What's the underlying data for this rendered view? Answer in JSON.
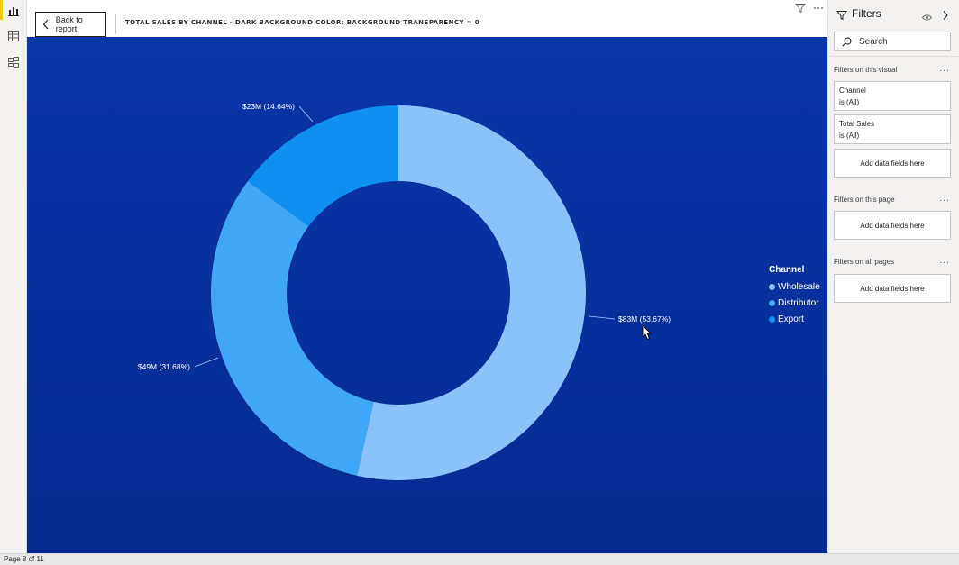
{
  "rail": {
    "items": [
      {
        "icon": "report-view-icon",
        "active": true
      },
      {
        "icon": "data-view-icon",
        "active": false
      },
      {
        "icon": "model-view-icon",
        "active": false
      }
    ]
  },
  "header": {
    "back_label": "Back to report",
    "visual_title": "TOTAL SALES BY CHANNEL - DARK BACKGROUND COLOR; BACKGROUND TRANSPARENCY = 0",
    "filter_icon": "funnel-icon",
    "more_icon": "more-options-icon"
  },
  "colors": {
    "background_top": "#0a36aa",
    "background_bottom": "#052b92",
    "wholesale": "#89c3f9",
    "distributor": "#3fa7f5",
    "export": "#0f8ff2",
    "label_text": "#ffffff"
  },
  "chart_data": {
    "type": "pie",
    "variant": "donut",
    "legend_title": "Channel",
    "legend_position": "right",
    "categories": [
      "Wholesale",
      "Distributor",
      "Export"
    ],
    "values": [
      83,
      49,
      23
    ],
    "percentages": [
      53.67,
      31.68,
      14.64
    ],
    "data_labels": [
      "$83M (53.67%)",
      "$49M (31.68%)",
      "$23M (14.64%)"
    ]
  },
  "filters": {
    "title": "Filters",
    "search_placeholder": "Search",
    "on_visual_label": "Filters on this visual",
    "on_page_label": "Filters on this page",
    "on_all_pages_label": "Filters on all pages",
    "more_label": "...",
    "cards": [
      {
        "field": "Channel",
        "state": "is (All)"
      },
      {
        "field": "Total Sales",
        "state": "is (All)"
      }
    ],
    "add_label": "Add data fields here"
  },
  "status": {
    "page_label": "Page 8 of 11"
  }
}
